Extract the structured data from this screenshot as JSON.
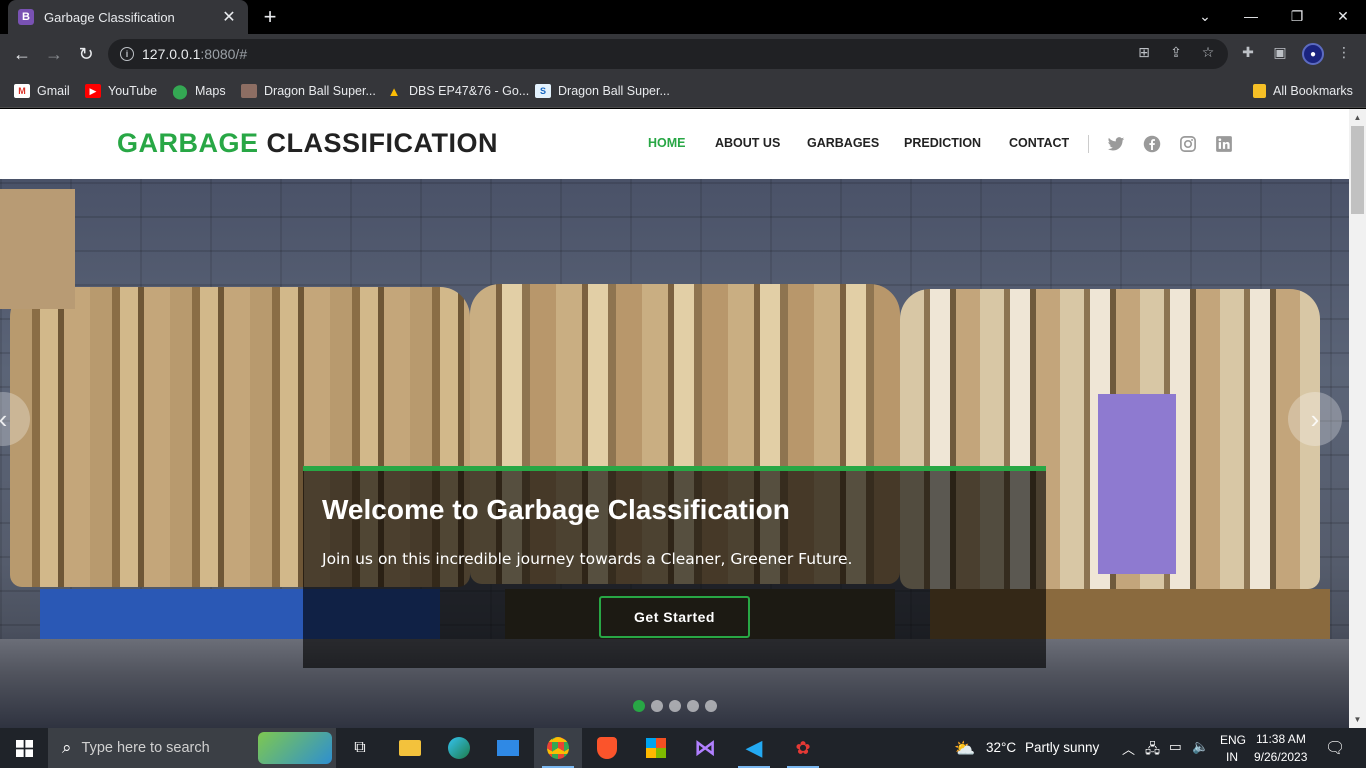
{
  "browser": {
    "tab_title": "Garbage Classification",
    "tab_favicon": "B",
    "url_host": "127.0.0.1",
    "url_rest": ":8080/#",
    "bookmarks": [
      {
        "label": "Gmail",
        "icon": "gmail-icon"
      },
      {
        "label": "YouTube",
        "icon": "youtube-icon"
      },
      {
        "label": "Maps",
        "icon": "maps-icon"
      },
      {
        "label": "Dragon Ball Super...",
        "icon": "bookmark-favicon"
      },
      {
        "label": "DBS EP47&76 - Go...",
        "icon": "google-drive-icon"
      },
      {
        "label": "Dragon Ball Super...",
        "icon": "bookmark-favicon"
      }
    ],
    "all_bookmarks": "All Bookmarks"
  },
  "site": {
    "logo_accent": "GARBAGE",
    "logo_rest": "CLASSIFICATION",
    "nav": [
      {
        "label": "HOME",
        "active": true
      },
      {
        "label": "ABOUT US",
        "active": false
      },
      {
        "label": "GARBAGES",
        "active": false
      },
      {
        "label": "PREDICTION",
        "active": false
      },
      {
        "label": "CONTACT",
        "active": false
      }
    ],
    "social": [
      "twitter-icon",
      "facebook-icon",
      "instagram-icon",
      "linkedin-icon"
    ],
    "accent_color": "#28a745"
  },
  "hero": {
    "title": "Welcome to Garbage Classification",
    "subtitle": "Join us on this incredible journey towards a Cleaner, Greener Future.",
    "cta": "Get Started",
    "slide_count": 5,
    "active_slide": 1
  },
  "taskbar": {
    "search_placeholder": "Type here to search",
    "weather_temp": "32°C",
    "weather_desc": "Partly sunny",
    "lang_top": "ENG",
    "lang_bottom": "IN",
    "time": "11:38 AM",
    "date": "9/26/2023"
  }
}
